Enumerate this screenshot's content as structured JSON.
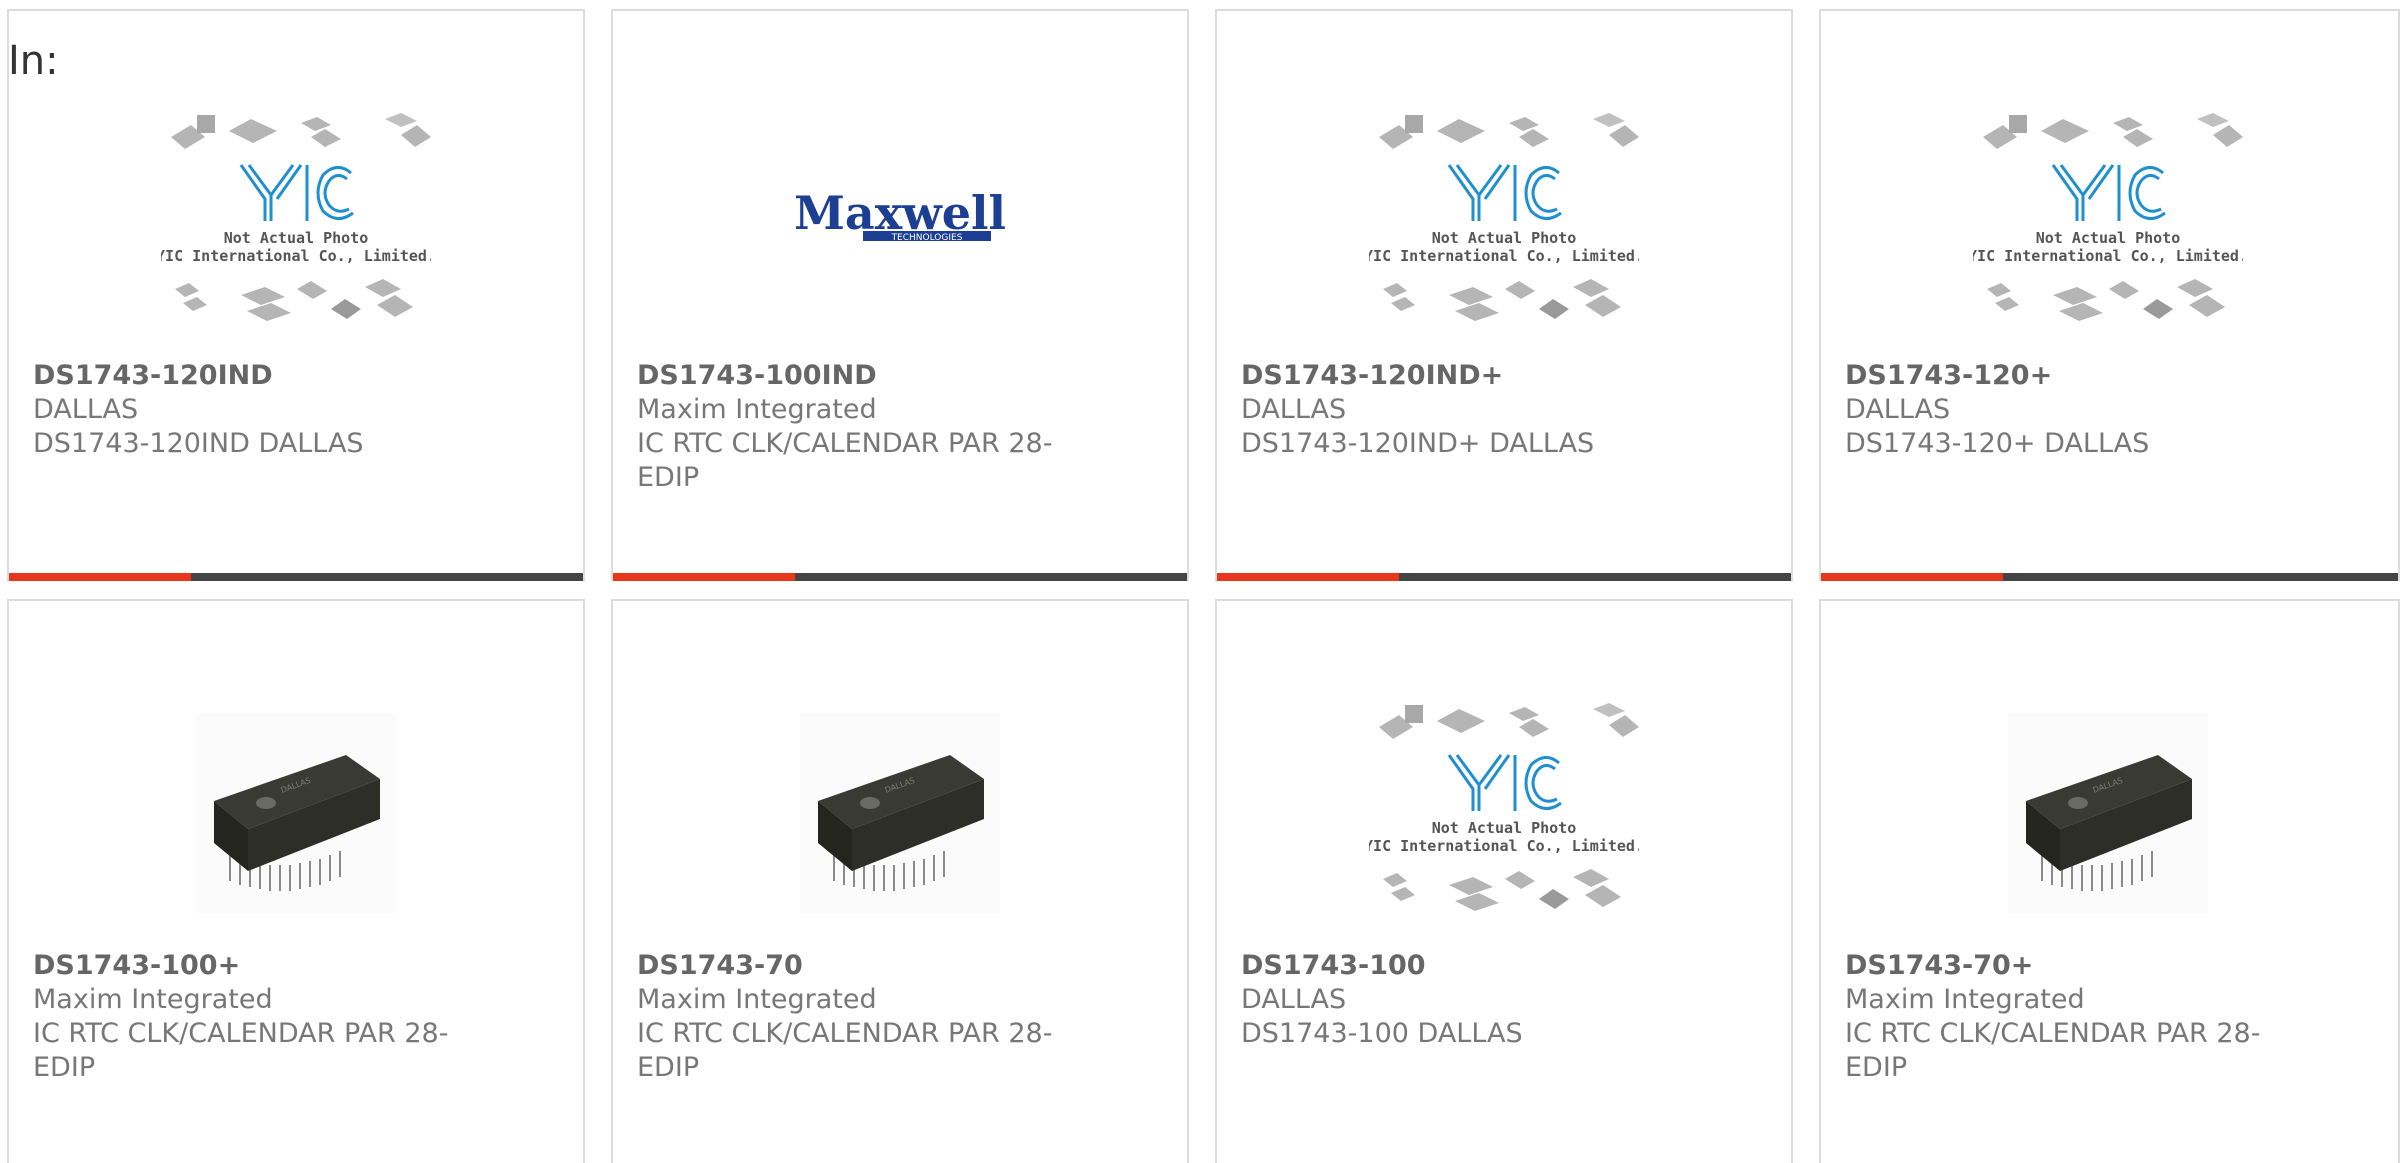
{
  "header": {
    "label": "In:"
  },
  "cards": [
    {
      "part_number": "DS1743-120IND",
      "manufacturer": "DALLAS",
      "description": "DS1743-120IND DALLAS",
      "image": "yic-placeholder",
      "placeholder": {
        "line1": "Not Actual Photo",
        "line2": "YIC International Co., Limited.",
        "logo": "YIC"
      }
    },
    {
      "part_number": "DS1743-100IND",
      "manufacturer": "Maxim Integrated",
      "description": "IC RTC CLK/CALENDAR PAR 28-EDIP",
      "image": "maxwell-logo",
      "logo": {
        "name": "Maxwell",
        "sub": "TECHNOLOGIES"
      }
    },
    {
      "part_number": "DS1743-120IND+",
      "manufacturer": "DALLAS",
      "description": "DS1743-120IND+ DALLAS",
      "image": "yic-placeholder",
      "placeholder": {
        "line1": "Not Actual Photo",
        "line2": "YIC International Co., Limited.",
        "logo": "YIC"
      }
    },
    {
      "part_number": "DS1743-120+",
      "manufacturer": "DALLAS",
      "description": "DS1743-120+ DALLAS",
      "image": "yic-placeholder",
      "placeholder": {
        "line1": "Not Actual Photo",
        "line2": "YIC International Co., Limited.",
        "logo": "YIC"
      }
    },
    {
      "part_number": "DS1743-100+",
      "manufacturer": "Maxim Integrated",
      "description": "IC RTC CLK/CALENDAR PAR 28-EDIP",
      "image": "edip-chip"
    },
    {
      "part_number": "DS1743-70",
      "manufacturer": "Maxim Integrated",
      "description": "IC RTC CLK/CALENDAR PAR 28-EDIP",
      "image": "edip-chip"
    },
    {
      "part_number": "DS1743-100",
      "manufacturer": "DALLAS",
      "description": "DS1743-100 DALLAS",
      "image": "yic-placeholder",
      "placeholder": {
        "line1": "Not Actual Photo",
        "line2": "YIC International Co., Limited.",
        "logo": "YIC"
      }
    },
    {
      "part_number": "DS1743-70+",
      "manufacturer": "Maxim Integrated",
      "description": "IC RTC CLK/CALENDAR PAR 28-EDIP",
      "image": "edip-chip"
    }
  ],
  "colors": {
    "accent": "#e8371a",
    "bar": "#444444",
    "border": "#dcdcdc",
    "text": "#777777",
    "yic_blue": "#1f8fd0"
  }
}
